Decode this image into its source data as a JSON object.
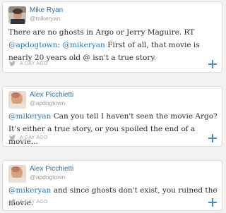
{
  "tweets": [
    {
      "author": {
        "name": "Mike Ryan",
        "handle": "@mikeryan"
      },
      "text_parts": [
        "There are no ghosts in Argo or Jerry Maguire. RT ",
        "@apdogtown",
        ": ",
        "@mikeryan",
        " First of all, that movie is nearly 20 years old @ isn't a true story."
      ],
      "time": "A DAY AGO"
    },
    {
      "author": {
        "name": "Alex Picchietti",
        "handle": "@apdogtown"
      },
      "text_parts": [
        "@mikeryan",
        " Can you tell I haven't seen the movie Argo? It's either a true story, or you spoiled the end of a movie..."
      ],
      "time": "A DAY AGO"
    },
    {
      "author": {
        "name": "Alex Picchietti",
        "handle": "@apdogtown"
      },
      "text_parts": [
        "@mikeryan",
        " and since ghosts don't exist, you ruined the movie."
      ],
      "time": "A DAY AGO"
    }
  ],
  "icons": {
    "bird": "twitter-bird-icon",
    "plus": "plus-icon"
  },
  "colors": {
    "link": "#2a7ab8",
    "name": "#2a6ea8",
    "meta": "#a6a6a6",
    "plus": "#4a8bc7"
  }
}
